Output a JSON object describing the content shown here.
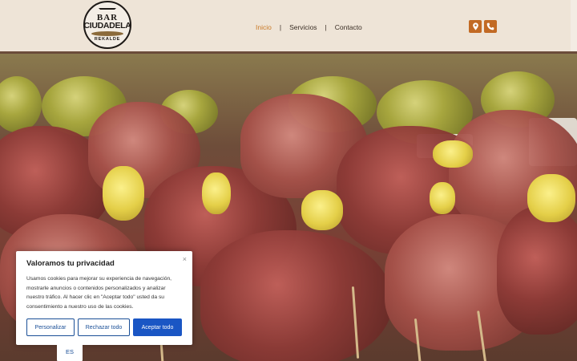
{
  "logo": {
    "top": "BAR",
    "name": "CIUDADELA",
    "sub": "REKALDE"
  },
  "nav": {
    "items": [
      {
        "label": "Inicio"
      },
      {
        "label": "Servicios"
      },
      {
        "label": "Contacto"
      }
    ],
    "active": "Inicio",
    "separator": "|"
  },
  "header_icons": [
    "location-pin-icon",
    "phone-icon"
  ],
  "colors": {
    "accent": "#c26a24",
    "nav_active": "#c97a28",
    "header_bg": "#eee4d7",
    "button_blue": "#1a56c4"
  },
  "cookie": {
    "title": "Valoramos tu privacidad",
    "close": "×",
    "text": "Usamos cookies para mejorar su experiencia de navegación, mostrarle anuncios o contenidos personalizados y analizar nuestro tráfico. Al hacer clic en \"Aceptar todo\" usted da su consentimiento a nuestro uso de las cookies.",
    "buttons": {
      "customize": "Personalizar",
      "reject": "Rechazar todo",
      "accept": "Aceptar todo"
    }
  },
  "language": "ES"
}
